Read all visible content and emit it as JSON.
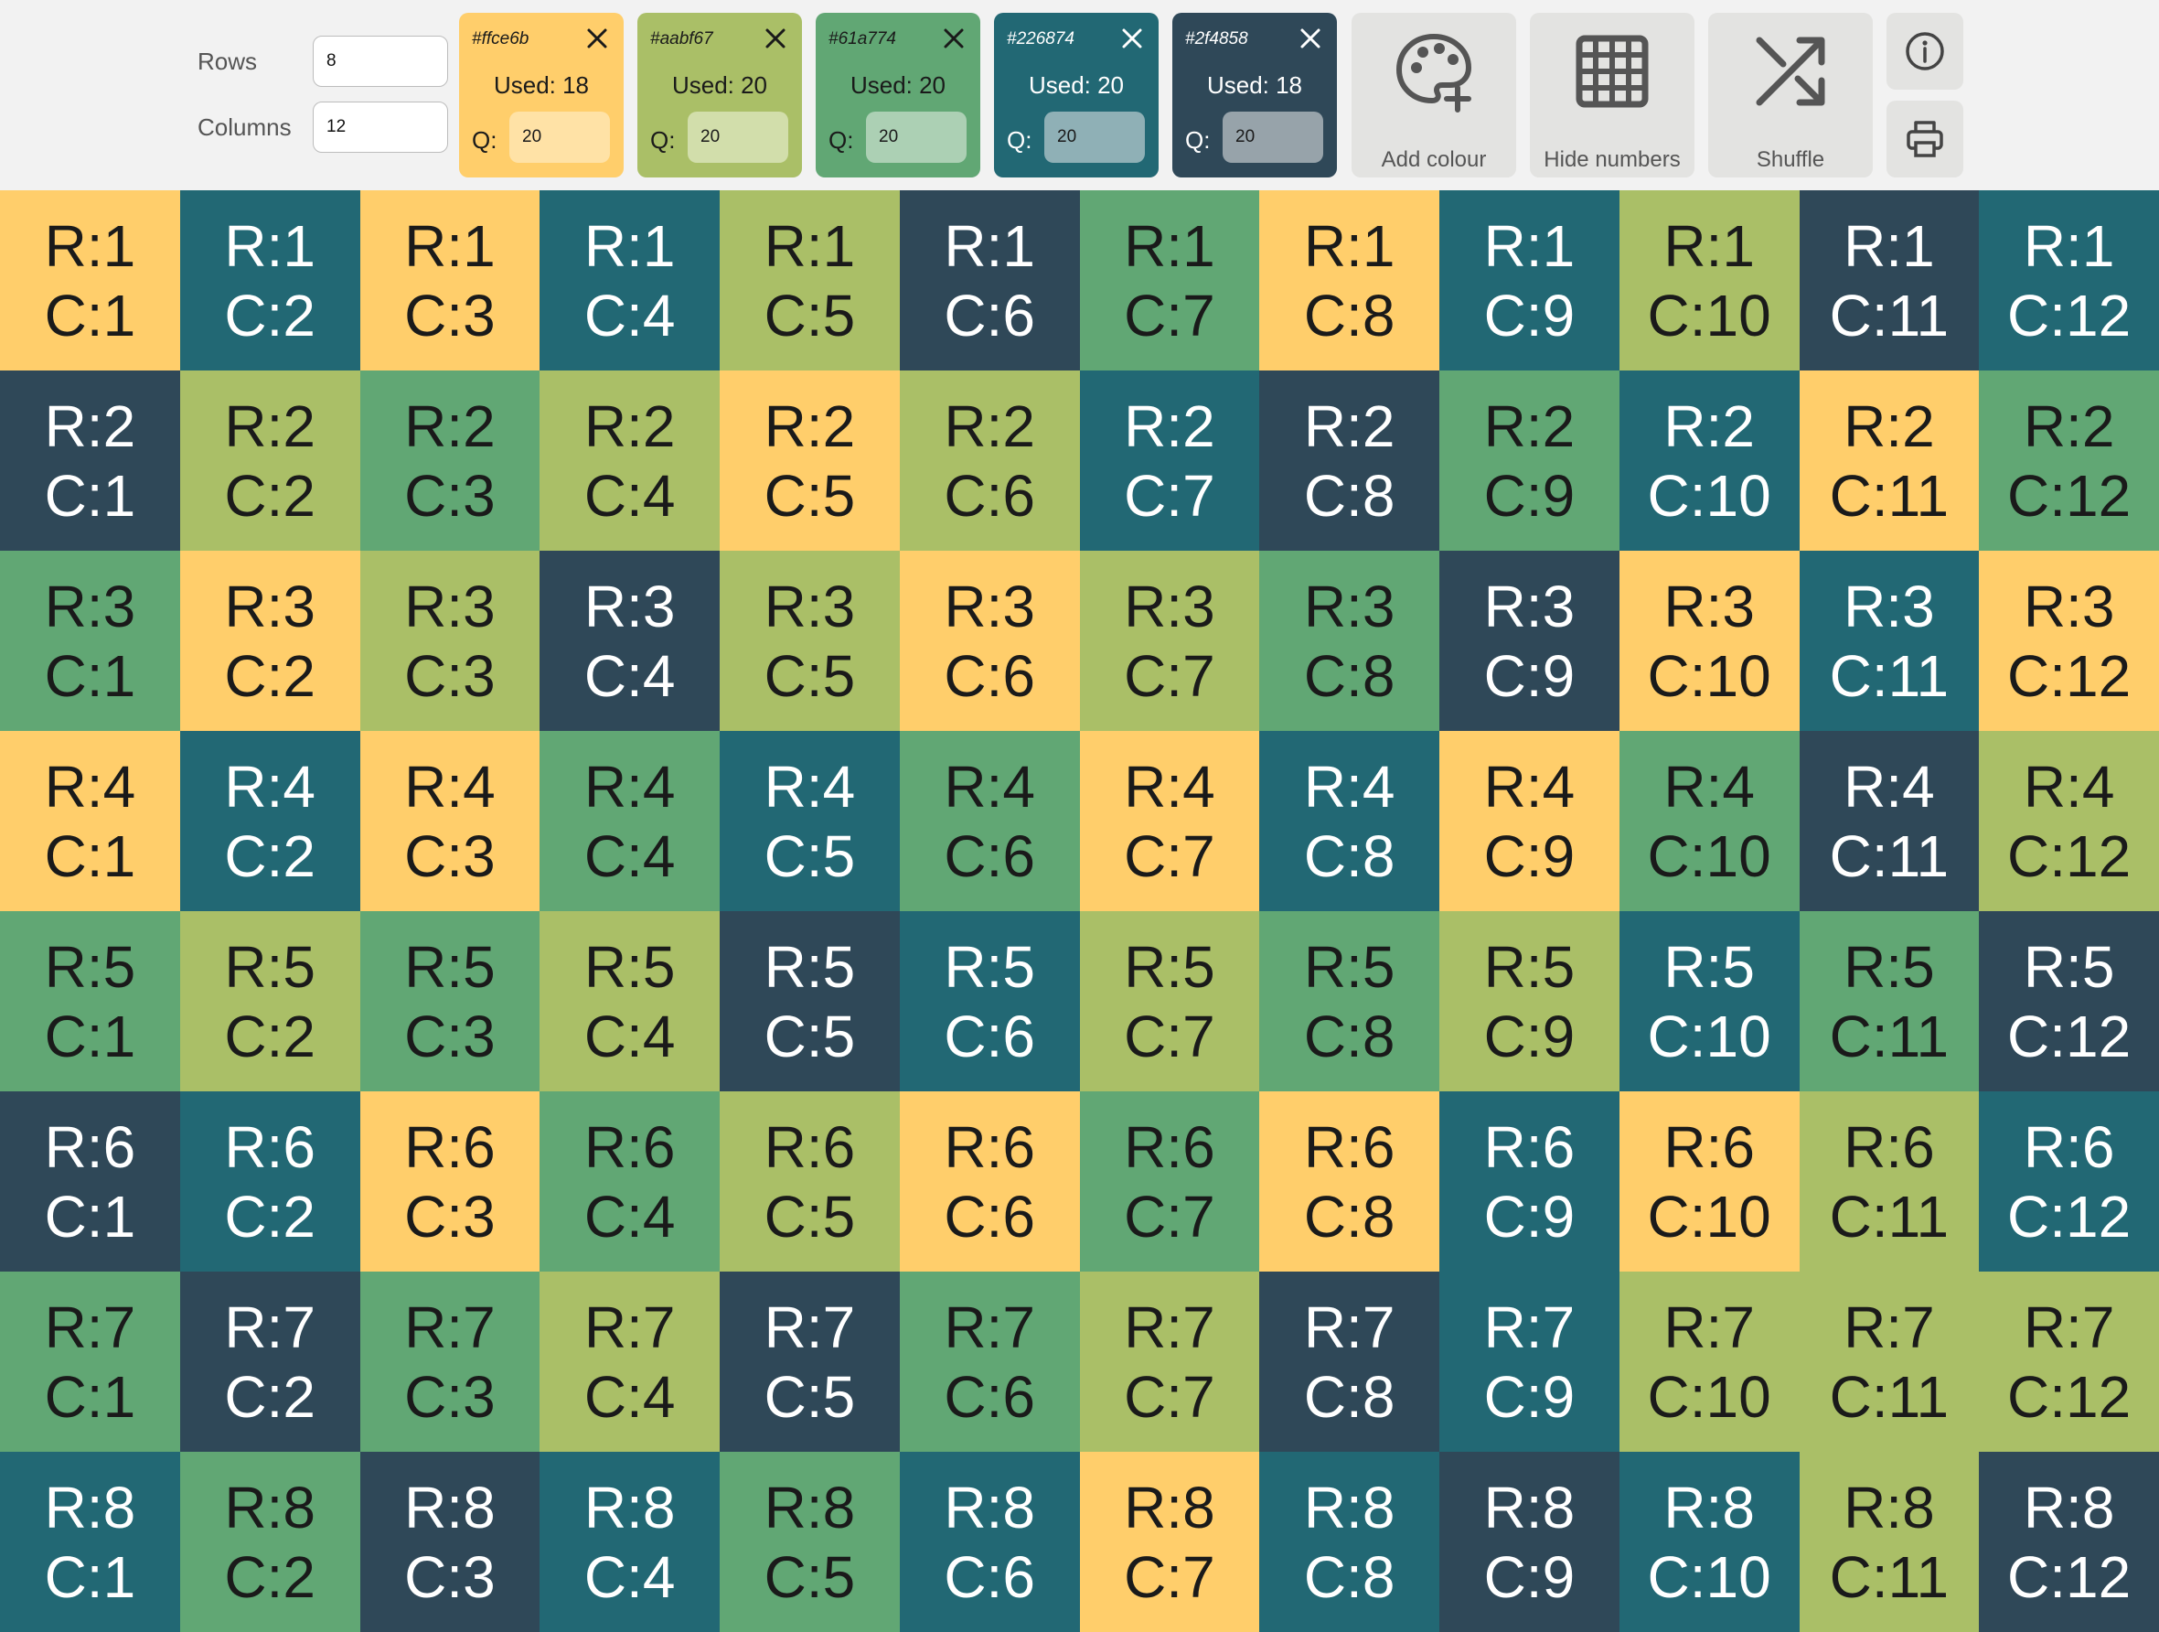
{
  "controls": {
    "rows_label": "Rows",
    "rows_value": "8",
    "columns_label": "Columns",
    "columns_value": "12"
  },
  "palette": [
    {
      "hex": "#ffce6b",
      "used": "Used: 18",
      "q_label": "Q:",
      "q_value": "20",
      "text": "light",
      "input_bg": "#ffe2a6"
    },
    {
      "hex": "#aabf67",
      "used": "Used: 20",
      "q_label": "Q:",
      "q_value": "20",
      "text": "light",
      "input_bg": "#d2deab"
    },
    {
      "hex": "#61a774",
      "used": "Used: 20",
      "q_label": "Q:",
      "q_value": "20",
      "text": "light",
      "input_bg": "#acd0b4"
    },
    {
      "hex": "#226874",
      "used": "Used: 20",
      "q_label": "Q:",
      "q_value": "20",
      "text": "dark",
      "input_bg": "#8fb0b6"
    },
    {
      "hex": "#2f4858",
      "used": "Used: 18",
      "q_label": "Q:",
      "q_value": "20",
      "text": "dark",
      "input_bg": "#97a3aa"
    }
  ],
  "tools": {
    "add_colour": "Add colour",
    "hide_numbers": "Hide numbers",
    "shuffle": "Shuffle"
  },
  "icons": {
    "close": "close-icon",
    "add_colour": "palette-plus-icon",
    "hide_numbers": "grid-icon",
    "shuffle": "shuffle-icon",
    "info": "info-icon",
    "print": "printer-icon"
  },
  "grid": {
    "rows": 8,
    "columns": 12,
    "row_prefix": "R:",
    "col_prefix": "C:",
    "cells": [
      [
        0,
        3,
        0,
        3,
        1,
        4,
        2,
        0,
        3,
        1,
        4,
        3
      ],
      [
        4,
        1,
        2,
        1,
        0,
        1,
        3,
        4,
        2,
        3,
        0,
        2
      ],
      [
        2,
        0,
        1,
        4,
        1,
        0,
        1,
        2,
        4,
        0,
        3,
        0
      ],
      [
        0,
        3,
        0,
        2,
        3,
        2,
        0,
        3,
        0,
        2,
        4,
        1
      ],
      [
        2,
        1,
        2,
        1,
        4,
        3,
        1,
        2,
        1,
        3,
        2,
        4
      ],
      [
        4,
        3,
        0,
        2,
        1,
        0,
        2,
        0,
        3,
        0,
        1,
        3
      ],
      [
        2,
        4,
        2,
        1,
        4,
        2,
        1,
        4,
        3,
        1,
        1,
        1
      ],
      [
        3,
        2,
        4,
        3,
        2,
        3,
        0,
        3,
        4,
        3,
        1,
        4
      ]
    ]
  }
}
